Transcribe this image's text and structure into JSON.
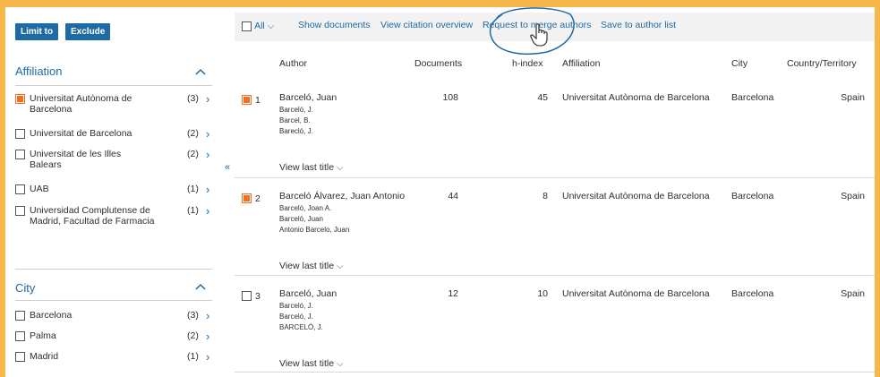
{
  "sidebar": {
    "limit_label": "Limit to",
    "exclude_label": "Exclude",
    "affiliation": {
      "title": "Affiliation",
      "items": [
        {
          "label": "Universitat Autònoma de Barcelona",
          "count": "(3)",
          "checked": true
        },
        {
          "label": "Universitat de Barcelona",
          "count": "(2)",
          "checked": false
        },
        {
          "label": "Universitat de les Illes Balears",
          "count": "(2)",
          "checked": false
        },
        {
          "label": "UAB",
          "count": "(1)",
          "checked": false
        },
        {
          "label": "Universidad Complutense de Madrid, Facultad de Farmacia",
          "count": "(1)",
          "checked": false
        }
      ]
    },
    "city": {
      "title": "City",
      "items": [
        {
          "label": "Barcelona",
          "count": "(3)",
          "checked": false
        },
        {
          "label": "Palma",
          "count": "(2)",
          "checked": false
        },
        {
          "label": "Madrid",
          "count": "(1)",
          "checked": false
        }
      ]
    }
  },
  "toolbar": {
    "all_label": "All",
    "show_documents": "Show documents",
    "view_citation": "View citation overview",
    "request_merge": "Request to merge authors",
    "save_list": "Save to author list"
  },
  "table": {
    "headers": {
      "author": "Author",
      "documents": "Documents",
      "h_index": "h-index",
      "affiliation": "Affiliation",
      "city": "City",
      "country": "Country/Territory"
    },
    "view_last_title": "View last title",
    "rows": [
      {
        "num": "1",
        "name": "Barceló, Juan",
        "variants": [
          "Barceló, J.",
          "Barcel, B.",
          "Barecló, J."
        ],
        "documents": "108",
        "h_index": "45",
        "affiliation": "Universitat Autònoma de Barcelona",
        "city": "Barcelona",
        "country": "Spain",
        "checked": true
      },
      {
        "num": "2",
        "name": "Barceló Álvarez, Juan Antonio",
        "variants": [
          "Barceló, Joan A.",
          "Barceló, Juan",
          "Antonio Barcelo, Juan"
        ],
        "documents": "44",
        "h_index": "8",
        "affiliation": "Universitat Autònoma de Barcelona",
        "city": "Barcelona",
        "country": "Spain",
        "checked": true
      },
      {
        "num": "3",
        "name": "Barceló, Juan",
        "variants": [
          "Barceló, J.",
          "Barceló, J.",
          "BARCELÓ, J."
        ],
        "documents": "12",
        "h_index": "10",
        "affiliation": "Universitat Autònoma de Barcelona",
        "city": "Barcelona",
        "country": "Spain",
        "checked": false
      }
    ]
  },
  "colors": {
    "accent": "#1d6aa5",
    "checked": "#f0701f",
    "frame": "#f7b74a"
  }
}
